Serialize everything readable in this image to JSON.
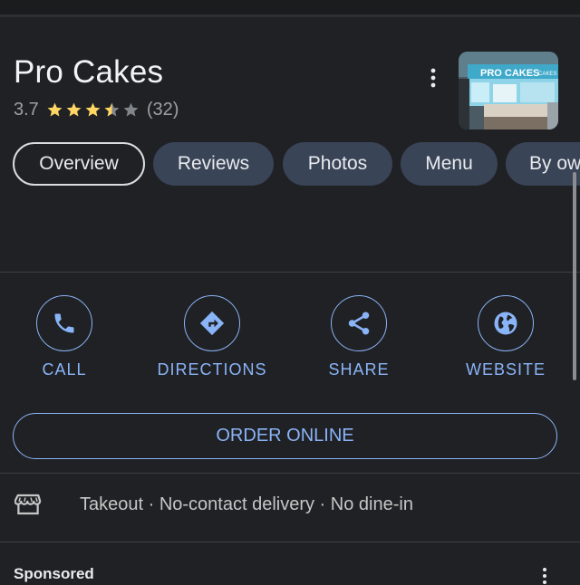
{
  "place": {
    "name": "Pro Cakes",
    "rating": "3.7",
    "rating_value": 3.7,
    "review_count": "(32)",
    "photo_sign": "PRO CAKES",
    "photo_sign_small": "CAKES"
  },
  "icons": {
    "more": "more-vert-icon",
    "star": "star-icon",
    "call": "phone-icon",
    "directions": "directions-icon",
    "share": "share-icon",
    "website": "globe-icon",
    "storefront": "storefront-icon"
  },
  "tabs": [
    {
      "label": "Overview",
      "active": true
    },
    {
      "label": "Reviews",
      "active": false
    },
    {
      "label": "Photos",
      "active": false
    },
    {
      "label": "Menu",
      "active": false
    },
    {
      "label": "By ow",
      "active": false
    }
  ],
  "actions": [
    {
      "label": "CALL"
    },
    {
      "label": "DIRECTIONS"
    },
    {
      "label": "SHARE"
    },
    {
      "label": "WEBSITE"
    }
  ],
  "order_button": "ORDER ONLINE",
  "service_options": "Takeout · No-contact delivery · No dine-in",
  "sponsored_label": "Sponsored",
  "colors": {
    "background": "#202124",
    "accent": "#8ab4f8",
    "star": "#fdd663",
    "tab_fill": "#394457"
  }
}
